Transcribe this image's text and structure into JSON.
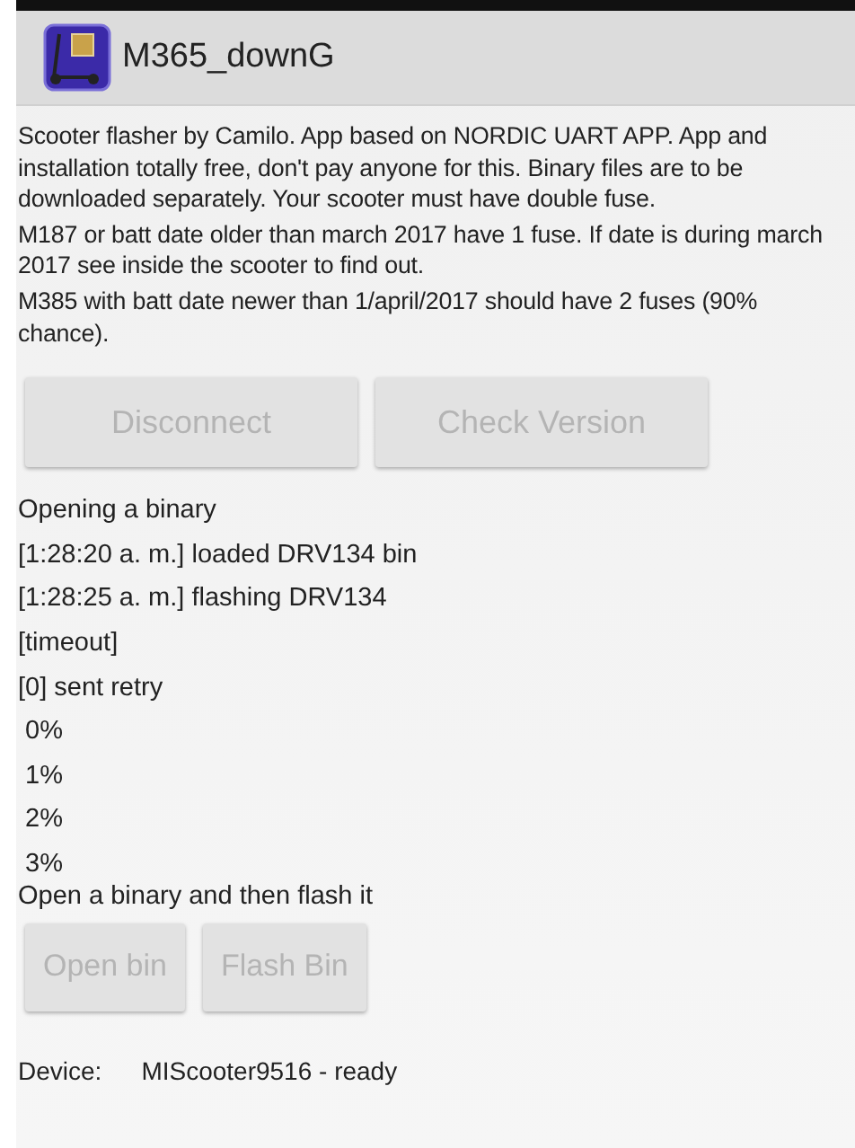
{
  "app_bar": {
    "title": "M365_downG"
  },
  "info": [
    "Scooter flasher by Camilo. App based on NORDIC UART APP. App and installation totally free, don't pay anyone for this. Binary files are to be downloaded separately. Your scooter must have double fuse.",
    "M187 or batt date older than march 2017 have 1 fuse. If date is during march 2017 see inside the scooter to find out.",
    "M385 with batt date newer than 1/april/2017 should have 2 fuses (90% chance)."
  ],
  "top_buttons": [
    {
      "label": "Disconnect",
      "disabled": true
    },
    {
      "label": "Check Version",
      "disabled": true
    }
  ],
  "log": [
    {
      "text": "Opening a binary",
      "kind": "message"
    },
    {
      "text": "[1:28:20 a. m.] loaded DRV134 bin",
      "kind": "message"
    },
    {
      "text": "[1:28:25 a. m.] flashing DRV134",
      "kind": "message"
    },
    {
      "text": "[timeout]",
      "kind": "message"
    },
    {
      "text": "[0] sent retry",
      "kind": "message"
    },
    {
      "text": "0%",
      "kind": "progress"
    },
    {
      "text": "1%",
      "kind": "progress"
    },
    {
      "text": "2%",
      "kind": "progress"
    },
    {
      "text": "3%",
      "kind": "progress"
    }
  ],
  "hint": "Open a binary and then flash it",
  "bottom_buttons": [
    {
      "label": "Open bin",
      "disabled": true
    },
    {
      "label": "Flash Bin",
      "disabled": true
    }
  ],
  "device": {
    "label": "Device:",
    "value": "MIScooter9516 - ready"
  }
}
